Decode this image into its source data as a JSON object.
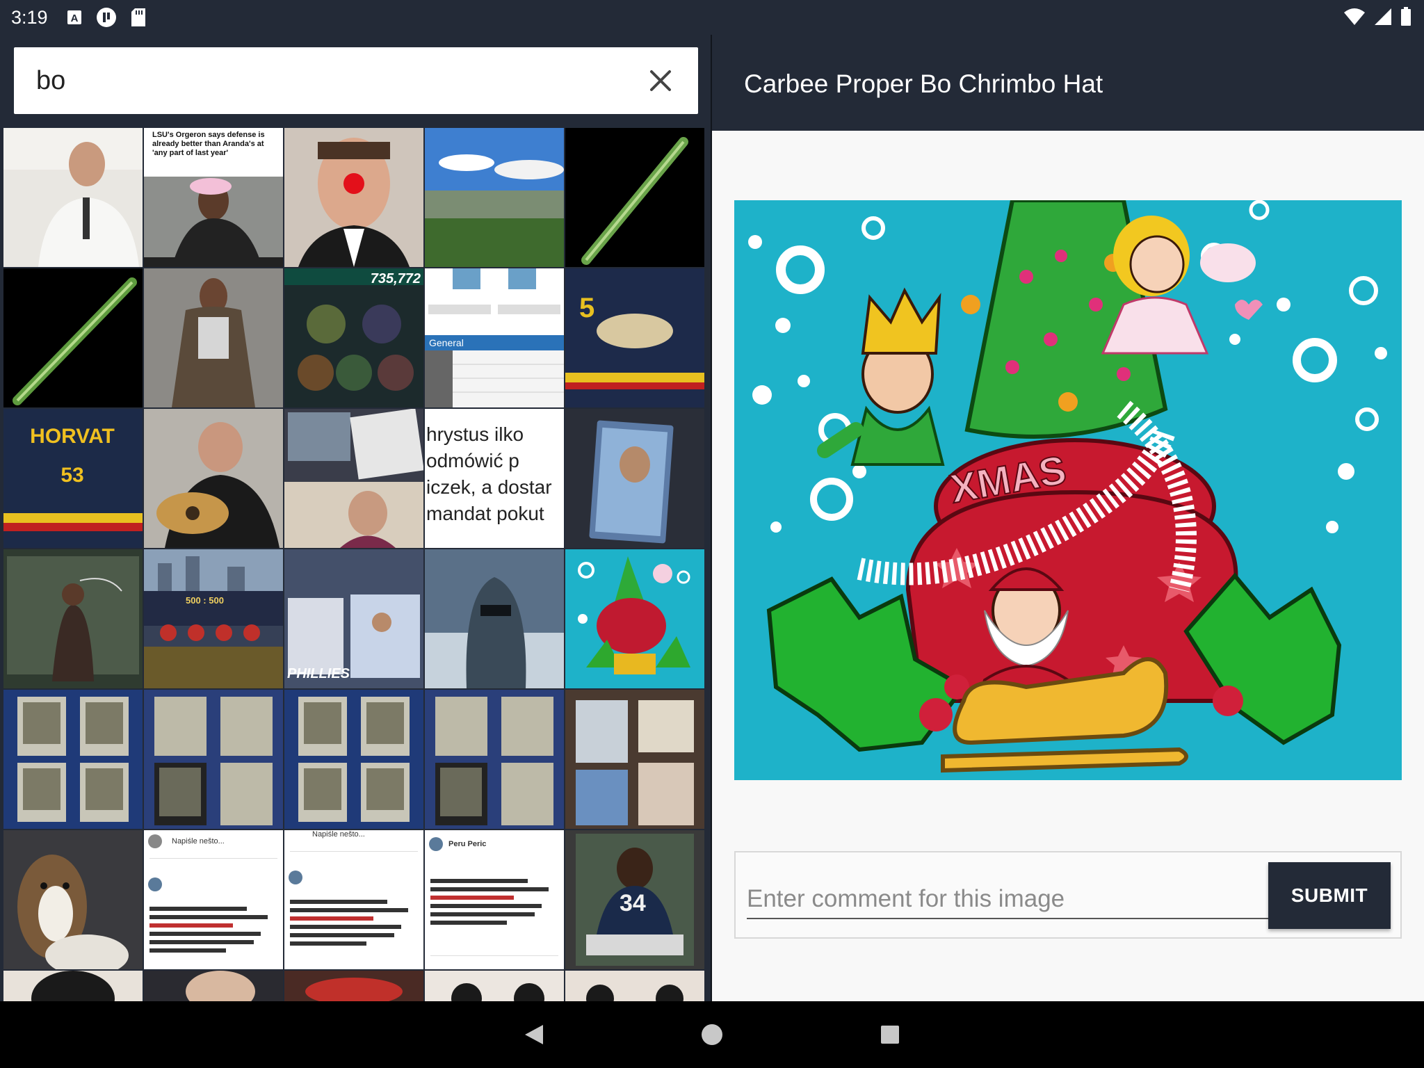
{
  "status_bar": {
    "time": "3:19",
    "left_icons": [
      "text-a-icon",
      "badge-icon",
      "sd-card-icon"
    ],
    "right_icons": [
      "wifi-icon",
      "signal-icon",
      "battery-icon"
    ]
  },
  "search": {
    "query": "bo",
    "clear_icon": "close-icon"
  },
  "grid": {
    "tiles": [
      {
        "caption": ""
      },
      {
        "caption": "LSU's Orgeron says defense is already better than Aranda's at 'any part of last year'"
      },
      {
        "caption": ""
      },
      {
        "caption": ""
      },
      {
        "caption": ""
      },
      {
        "caption": ""
      },
      {
        "caption": ""
      },
      {
        "caption": "735,772"
      },
      {
        "caption": "General"
      },
      {
        "caption": ""
      },
      {
        "caption": "HORVAT 53"
      },
      {
        "caption": ""
      },
      {
        "caption": ""
      },
      {
        "caption": "hrystus ilko odmówić p iczek, a dostar mandat pokut"
      },
      {
        "caption": ""
      },
      {
        "caption": ""
      },
      {
        "caption": "500 : 500"
      },
      {
        "caption": "PHILLIES"
      },
      {
        "caption": ""
      },
      {
        "caption": ""
      },
      {
        "caption": ""
      },
      {
        "caption": ""
      },
      {
        "caption": ""
      },
      {
        "caption": ""
      },
      {
        "caption": ""
      },
      {
        "caption": ""
      },
      {
        "caption": "Napiśle nešto..."
      },
      {
        "caption": "Napiśle nešto..."
      },
      {
        "caption": "Peru Peric"
      },
      {
        "caption": "34"
      }
    ]
  },
  "detail": {
    "title": "Carbee Proper Bo Chrimbo Hat",
    "comment_placeholder": "Enter comment for this image",
    "submit_label": "SUBMIT"
  },
  "nav": {
    "back_icon": "back-triangle-icon",
    "home_icon": "home-circle-icon",
    "recents_icon": "recents-square-icon"
  },
  "colors": {
    "chrome": "#232a37",
    "preview_bg": "#1eb2c9",
    "panel_bg": "#f8f8f8"
  }
}
